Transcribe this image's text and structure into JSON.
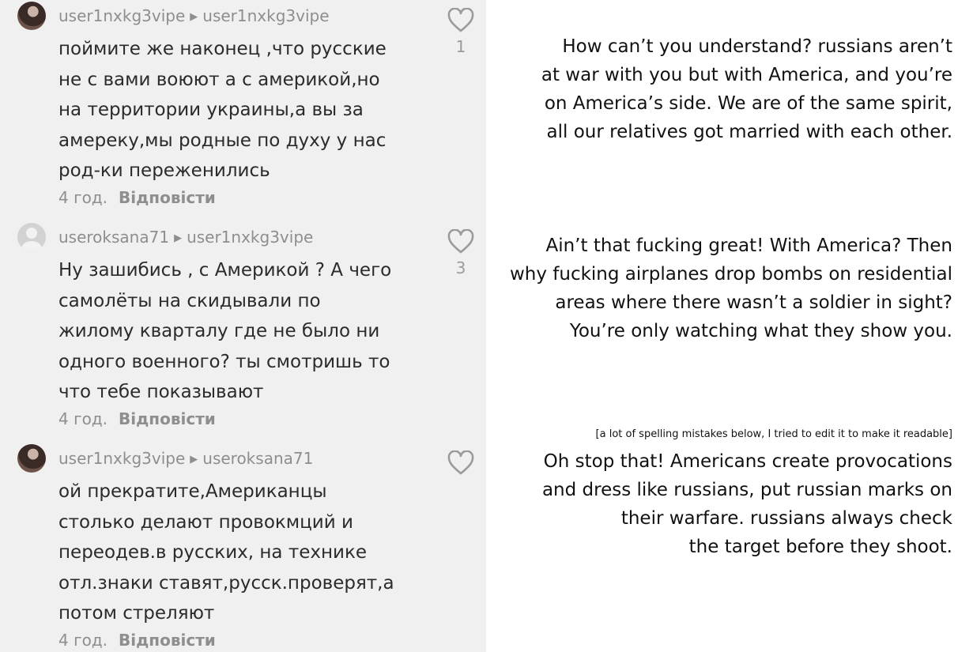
{
  "colors": {
    "panel_bg": "#f0f0f0",
    "comment_text": "#2b2b2b",
    "meta_text": "#8e8e8e",
    "heart_outline": "#9b9b9b"
  },
  "comments": [
    {
      "avatar": "profile-photo",
      "author": "user1nxkg3vipe",
      "reply_to": "user1nxkg3vipe",
      "text": "поймите же наконец ,что русские\nне с вами воюют а с америкой,но\nна территории украины,а вы за\nамереку,мы родные по духу у нас\nрод-ки переженились",
      "time": "4 год.",
      "reply_label": "Відповісти",
      "likes": "1"
    },
    {
      "avatar": "default-avatar",
      "author": "useroksana71",
      "reply_to": "user1nxkg3vipe",
      "text": "Ну зашибись , с Америкой ? А чего\nсамолёты на скидывали по\nжилому кварталу где не было ни\nодного военного? ты смотришь то\nчто тебе показывают",
      "time": "4 год.",
      "reply_label": "Відповісти",
      "likes": "3"
    },
    {
      "avatar": "profile-photo",
      "author": "user1nxkg3vipe",
      "reply_to": "useroksana71",
      "text": "ой прекратите,Американцы\nстолько делают провокмций и\nпереодев.в русских, на технике\nотл.знаки ставят,русск.проверят,а\nпотом стреляют",
      "time": "4 год.",
      "reply_label": "Відповісти",
      "likes": ""
    }
  ],
  "translations": [
    "How can’t you understand? russians aren’t\nat war with you but with America, and you’re\non America’s side. We are of the same spirit,\nall our relatives got married with each other.",
    "Ain’t that fucking great! With America? Then\nwhy fucking airplanes drop bombs on residential\nareas where there wasn’t a soldier in sight?\nYou’re only watching what they show you.",
    "Oh stop that! Americans create provocations\nand dress like russians, put russian marks on\ntheir warfare. russians always check\nthe target before they shoot."
  ],
  "translator_note": "[a lot of spelling mistakes below, I tried to edit it to make it readable]"
}
